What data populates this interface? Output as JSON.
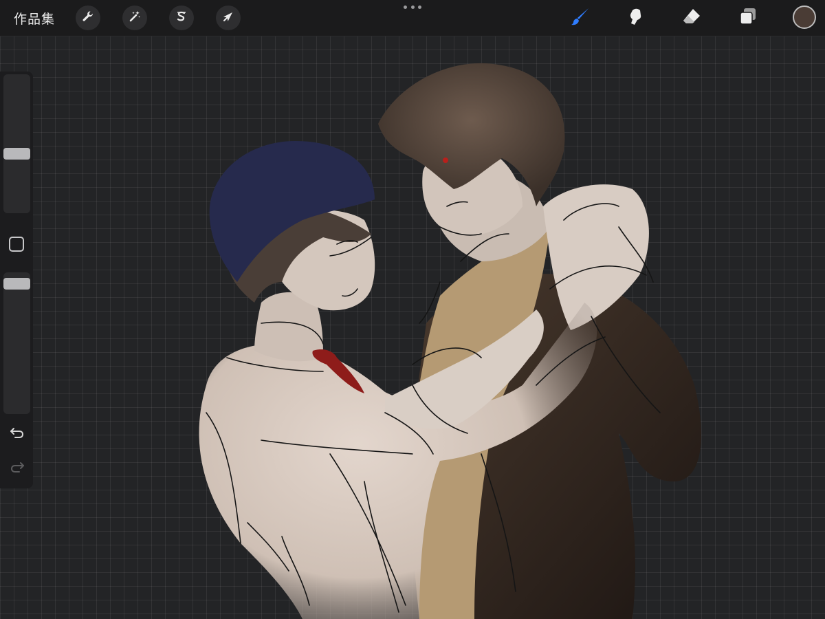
{
  "topbar": {
    "gallery_label": "作品集",
    "left_tools": [
      {
        "icon": "wrench-icon",
        "name": "actions"
      },
      {
        "icon": "magic-wand-icon",
        "name": "adjustments"
      },
      {
        "icon": "selection-s-icon",
        "name": "selection"
      },
      {
        "icon": "arrow-cursor-icon",
        "name": "transform"
      }
    ],
    "right_tools": [
      {
        "icon": "brush-icon",
        "name": "paint",
        "active": true
      },
      {
        "icon": "smudge-icon",
        "name": "smudge",
        "active": false
      },
      {
        "icon": "eraser-icon",
        "name": "erase",
        "active": false
      },
      {
        "icon": "layers-icon",
        "name": "layers",
        "active": false
      }
    ],
    "current_color": "#4a3c35",
    "active_color": "#2f7dff"
  },
  "sidebar": {
    "brush_size_level": 0.42,
    "opacity_level": 0.96,
    "modify_icon": "square-modify-icon",
    "undo_icon": "undo-icon",
    "redo_icon": "redo-icon"
  },
  "canvas": {
    "grid": true,
    "background": "#232426"
  }
}
